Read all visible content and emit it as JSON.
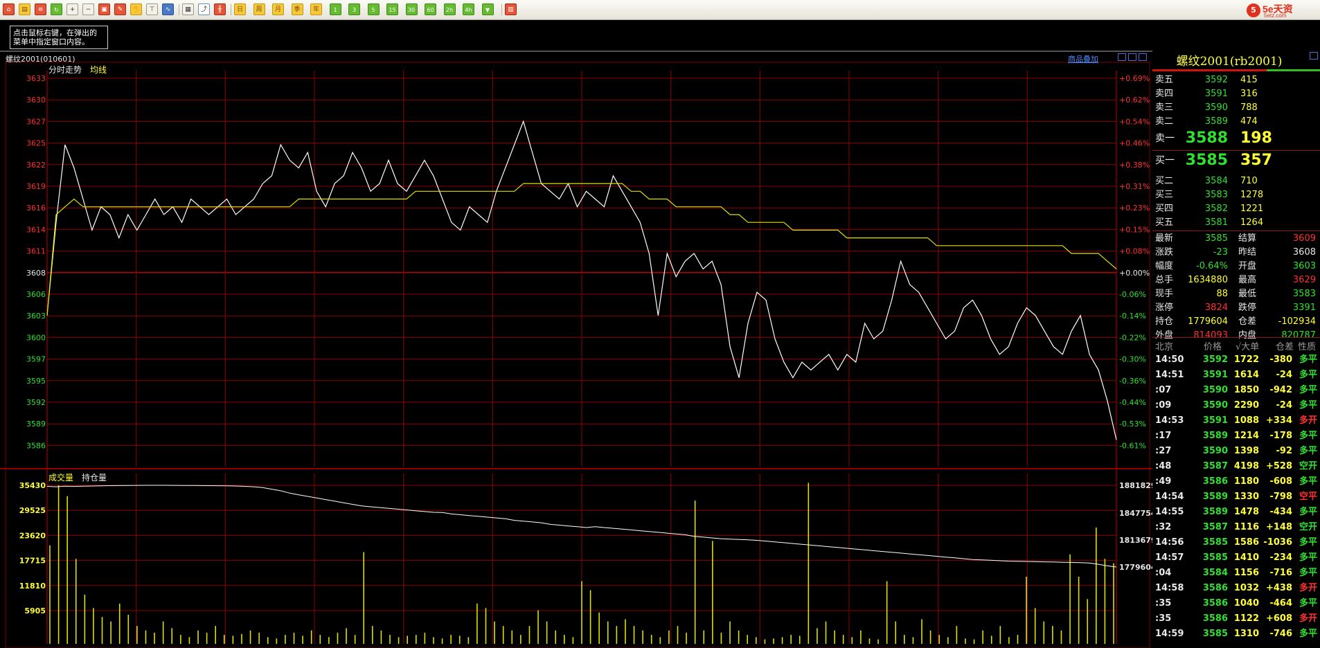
{
  "colors": {
    "red": "#ff3030",
    "green": "#30e030",
    "yellow": "#ffff33",
    "white": "#e8e8e8",
    "grid": "#8b0000",
    "price_line": "#ffffff",
    "avg_line": "#e0e000",
    "volume_bar": "#e0e000"
  },
  "toolbar": {
    "buttons": [
      {
        "name": "home-icon",
        "text": "⌂",
        "style": "r"
      },
      {
        "name": "folder-icon",
        "text": "▤",
        "style": "y"
      },
      {
        "name": "news-icon",
        "text": "≡",
        "style": "r"
      },
      {
        "name": "refresh-icon",
        "text": "↻",
        "style": "g"
      },
      {
        "name": "zoom-in-icon",
        "text": "+",
        "style": ""
      },
      {
        "name": "zoom-out-icon",
        "text": "−",
        "style": ""
      },
      {
        "name": "color-icon",
        "text": "▣",
        "style": "r"
      },
      {
        "name": "pen-icon",
        "text": "✎",
        "style": "r"
      },
      {
        "name": "hand-icon",
        "text": "✋",
        "style": "y"
      },
      {
        "name": "brush-icon",
        "text": "⊤",
        "style": ""
      },
      {
        "name": "trend-icon",
        "text": "∿",
        "style": "b"
      },
      {
        "name": "table-icon",
        "text": "▦",
        "style": ""
      },
      {
        "name": "intraday-chart-icon",
        "text": "⤴",
        "style": "active"
      },
      {
        "name": "kline-icon",
        "text": "╫",
        "style": "r"
      },
      {
        "name": "day-button",
        "text": "日",
        "style": "y"
      },
      {
        "name": "week-button",
        "text": "周",
        "style": "y"
      },
      {
        "name": "month-button",
        "text": "月",
        "style": "y"
      },
      {
        "name": "quarter-button",
        "text": "季",
        "style": "y"
      },
      {
        "name": "year-button",
        "text": "年",
        "style": "y"
      },
      {
        "name": "min1-button",
        "text": "1",
        "style": "g"
      },
      {
        "name": "min3-button",
        "text": "3",
        "style": "g"
      },
      {
        "name": "min5-button",
        "text": "5",
        "style": "g"
      },
      {
        "name": "min15-button",
        "text": "15",
        "style": "g"
      },
      {
        "name": "min30-button",
        "text": "30",
        "style": "g"
      },
      {
        "name": "min60-button",
        "text": "60",
        "style": "g"
      },
      {
        "name": "hour2-button",
        "text": "2h",
        "style": "g"
      },
      {
        "name": "hour4-button",
        "text": "4h",
        "style": "g"
      },
      {
        "name": "filter-icon",
        "text": "▼",
        "style": "g"
      },
      {
        "name": "calendar-icon",
        "text": "▥",
        "style": "r"
      }
    ],
    "logo": {
      "badge": "5",
      "name": "5e天资",
      "domain": "5etz.com"
    }
  },
  "hint": {
    "line1": "点击鼠标右键，在弹出的",
    "line2": "菜单中指定窗口内容。"
  },
  "chart": {
    "title": "螺纹2001(010601)",
    "overlay_link": "商品叠加",
    "price_label": "分时走势",
    "avg_label": "均线",
    "volume_label": "成交量",
    "oi_label": "持仓量",
    "price_ticks": [
      "3633",
      "3630",
      "3627",
      "3625",
      "3622",
      "3619",
      "3616",
      "3614",
      "3611",
      "3608",
      "3606",
      "3603",
      "3600",
      "3597",
      "3595",
      "3592",
      "3589",
      "3586"
    ],
    "pct_ticks": [
      "+0.69%",
      "+0.62%",
      "+0.54%",
      "+0.46%",
      "+0.38%",
      "+0.31%",
      "+0.23%",
      "+0.15%",
      "+0.08%",
      "+0.00%",
      "-0.06%",
      "-0.14%",
      "-0.22%",
      "-0.30%",
      "-0.36%",
      "-0.44%",
      "-0.53%",
      "-0.61%"
    ],
    "volume_ticks": [
      "35430",
      "29525",
      "23620",
      "17715",
      "11810",
      "5905"
    ],
    "oi_ticks": [
      "1881829",
      "1847754",
      "1813679",
      "1779604"
    ]
  },
  "chart_data": {
    "type": "line",
    "title": "螺纹2001(010601)",
    "xlabel": "",
    "ylabel": "",
    "reference_price": 3608,
    "ylim": [
      3584,
      3634
    ],
    "series": [
      {
        "name": "分时走势",
        "values": [
          3603,
          3615,
          3625,
          3622,
          3618,
          3614,
          3617,
          3616,
          3613,
          3616,
          3614,
          3616,
          3618,
          3616,
          3617,
          3615,
          3618,
          3617,
          3616,
          3617,
          3618,
          3616,
          3617,
          3618,
          3620,
          3621,
          3625,
          3623,
          3622,
          3624,
          3619,
          3617,
          3620,
          3621,
          3624,
          3622,
          3619,
          3620,
          3623,
          3620,
          3619,
          3621,
          3623,
          3621,
          3618,
          3615,
          3614,
          3617,
          3616,
          3615,
          3619,
          3622,
          3625,
          3628,
          3624,
          3620,
          3619,
          3618,
          3620,
          3617,
          3619,
          3618,
          3617,
          3621,
          3619,
          3617,
          3615,
          3611,
          3603,
          3611,
          3608,
          3610,
          3611,
          3609,
          3610,
          3607,
          3599,
          3595,
          3602,
          3606,
          3605,
          3600,
          3597,
          3595,
          3597,
          3596,
          3597,
          3598,
          3596,
          3598,
          3597,
          3602,
          3600,
          3601,
          3605,
          3610,
          3607,
          3606,
          3604,
          3602,
          3600,
          3601,
          3604,
          3605,
          3603,
          3600,
          3598,
          3599,
          3602,
          3604,
          3603,
          3601,
          3599,
          3598,
          3601,
          3603,
          3598,
          3596,
          3592,
          3587
        ],
        "color": "#ffffff"
      },
      {
        "name": "均线",
        "values": [
          3603,
          3616,
          3617,
          3618,
          3617,
          3617,
          3617,
          3617,
          3617,
          3617,
          3617,
          3617,
          3617,
          3617,
          3617,
          3617,
          3617,
          3617,
          3617,
          3617,
          3617,
          3617,
          3617,
          3617,
          3617,
          3617,
          3617,
          3617,
          3618,
          3618,
          3618,
          3618,
          3618,
          3618,
          3618,
          3618,
          3618,
          3618,
          3618,
          3618,
          3618,
          3619,
          3619,
          3619,
          3619,
          3619,
          3619,
          3619,
          3619,
          3619,
          3619,
          3619,
          3619,
          3620,
          3620,
          3620,
          3620,
          3620,
          3620,
          3620,
          3620,
          3620,
          3620,
          3620,
          3620,
          3619,
          3619,
          3618,
          3618,
          3618,
          3617,
          3617,
          3617,
          3617,
          3617,
          3617,
          3616,
          3616,
          3615,
          3615,
          3615,
          3615,
          3615,
          3614,
          3614,
          3614,
          3614,
          3614,
          3614,
          3613,
          3613,
          3613,
          3613,
          3613,
          3613,
          3613,
          3613,
          3613,
          3613,
          3612,
          3612,
          3612,
          3612,
          3612,
          3612,
          3612,
          3612,
          3612,
          3612,
          3612,
          3612,
          3612,
          3612,
          3612,
          3611,
          3611,
          3611,
          3611,
          3610,
          3609
        ],
        "color": "#e0e000"
      }
    ],
    "volume": {
      "ylim": [
        0,
        35430
      ],
      "values": [
        22000,
        35430,
        33000,
        19000,
        11000,
        8000,
        6000,
        5000,
        9000,
        6500,
        4000,
        3000,
        2500,
        5000,
        3500,
        2000,
        1500,
        3000,
        2500,
        4000,
        2000,
        1800,
        2200,
        3000,
        2500,
        1500,
        1200,
        2000,
        2500,
        1800,
        3000,
        2000,
        1500,
        2500,
        3500,
        2000,
        20500,
        4000,
        3000,
        2000,
        1500,
        1800,
        2000,
        2500,
        1500,
        1200,
        2000,
        1800,
        1500,
        9000,
        8000,
        5000,
        4000,
        3000,
        2000,
        4000,
        7500,
        5000,
        3000,
        2000,
        1500,
        14000,
        12000,
        7000,
        5000,
        4000,
        5500,
        4000,
        3000,
        2000,
        1500,
        3000,
        4000,
        2500,
        32000,
        3000,
        23000,
        2500,
        5000,
        3000,
        2000,
        1500,
        1000,
        1200,
        1500,
        2000,
        1800,
        36000,
        3500,
        5000,
        3000,
        2000,
        1500,
        3000,
        1200,
        1000,
        14000,
        5000,
        2000,
        1500,
        5500,
        3000,
        2000,
        1500,
        4000,
        1200,
        1000,
        3000,
        1800,
        4000,
        1500,
        2000,
        15000,
        8000,
        5000,
        4000,
        3000,
        20000,
        15000,
        10000,
        26000,
        19000,
        18000
      ]
    },
    "open_interest": {
      "series_name": "持仓量",
      "ylim": [
        1779604,
        1881829
      ],
      "values": [
        1880500,
        1880000,
        1880800,
        1880500,
        1880800,
        1881000,
        1881200,
        1881400,
        1881500,
        1881600,
        1881700,
        1881800,
        1881829,
        1881800,
        1881700,
        1881600,
        1881600,
        1881500,
        1881400,
        1881300,
        1881200,
        1881000,
        1880500,
        1880000,
        1879000,
        1877000,
        1875000,
        1872000,
        1870000,
        1868000,
        1866000,
        1864000,
        1862000,
        1860000,
        1858000,
        1856000,
        1855000,
        1854000,
        1853000,
        1852000,
        1851000,
        1850000,
        1849000,
        1848000,
        1847754,
        1846000,
        1845000,
        1844000,
        1843000,
        1842000,
        1841000,
        1840000,
        1838000,
        1837000,
        1836000,
        1835000,
        1833000,
        1832000,
        1831000,
        1830000,
        1829000,
        1830000,
        1829000,
        1828000,
        1827000,
        1826000,
        1825000,
        1824000,
        1823000,
        1822000,
        1821000,
        1820000,
        1818000,
        1817000,
        1816000,
        1815000,
        1814500,
        1814000,
        1813679,
        1813000,
        1812000,
        1811000,
        1810000,
        1809000,
        1808000,
        1807000,
        1806000,
        1805000,
        1804000,
        1803000,
        1802000,
        1801000,
        1800000,
        1799000,
        1798000,
        1797000,
        1796000,
        1795000,
        1794000,
        1793000,
        1792000,
        1791000,
        1790000,
        1789000,
        1788500,
        1788000,
        1787500,
        1787000,
        1786800,
        1786500,
        1786300,
        1786000,
        1785800,
        1785500,
        1785300,
        1785000,
        1784500,
        1783000,
        1781000,
        1779604
      ]
    }
  },
  "quote": {
    "title": "螺纹2001(rb2001)",
    "asks": [
      {
        "label": "卖五",
        "price": "3592",
        "vol": "415"
      },
      {
        "label": "卖四",
        "price": "3591",
        "vol": "316"
      },
      {
        "label": "卖三",
        "price": "3590",
        "vol": "788"
      },
      {
        "label": "卖二",
        "price": "3589",
        "vol": "474"
      },
      {
        "label": "卖一",
        "price": "3588",
        "vol": "198"
      }
    ],
    "bids": [
      {
        "label": "买一",
        "price": "3585",
        "vol": "357"
      },
      {
        "label": "买二",
        "price": "3584",
        "vol": "710"
      },
      {
        "label": "买三",
        "price": "3583",
        "vol": "1278"
      },
      {
        "label": "买四",
        "price": "3582",
        "vol": "1221"
      },
      {
        "label": "买五",
        "price": "3581",
        "vol": "1264"
      }
    ],
    "stats": [
      {
        "l1": "最新",
        "v1": "3585",
        "c1": "green",
        "l2": "结算",
        "v2": "3609",
        "c2": "red"
      },
      {
        "l1": "涨跌",
        "v1": "-23",
        "c1": "green",
        "l2": "昨结",
        "v2": "3608",
        "c2": "white"
      },
      {
        "l1": "幅度",
        "v1": "-0.64%",
        "c1": "green",
        "l2": "开盘",
        "v2": "3603",
        "c2": "green"
      },
      {
        "l1": "总手",
        "v1": "1634880",
        "c1": "yellow",
        "l2": "最高",
        "v2": "3629",
        "c2": "red"
      },
      {
        "l1": "现手",
        "v1": "88",
        "c1": "yellow",
        "l2": "最低",
        "v2": "3583",
        "c2": "green"
      },
      {
        "l1": "涨停",
        "v1": "3824",
        "c1": "red",
        "l2": "跌停",
        "v2": "3391",
        "c2": "green"
      },
      {
        "l1": "持仓",
        "v1": "1779604",
        "c1": "yellow",
        "l2": "仓差",
        "v2": "-102934",
        "c2": "yellow"
      },
      {
        "l1": "外盘",
        "v1": "814093",
        "c1": "red",
        "l2": "内盘",
        "v2": "820787",
        "c2": "green"
      }
    ],
    "ticks_header": {
      "time": "北京",
      "price": "价格",
      "vol": "√大单",
      "diff": "仓差",
      "nature": "性质"
    },
    "ticks": [
      {
        "t": "14:50",
        "p": "3592",
        "v": "1722",
        "d": "-380",
        "n": "多平",
        "nc": "green"
      },
      {
        "t": "14:51",
        "p": "3591",
        "v": "1614",
        "d": "-24",
        "n": "多平",
        "nc": "green"
      },
      {
        "t": ":07",
        "p": "3590",
        "v": "1850",
        "d": "-942",
        "n": "多平",
        "nc": "green"
      },
      {
        "t": ":09",
        "p": "3590",
        "v": "2290",
        "d": "-24",
        "n": "多平",
        "nc": "green"
      },
      {
        "t": "14:53",
        "p": "3591",
        "v": "1088",
        "d": "+334",
        "n": "多开",
        "nc": "red"
      },
      {
        "t": ":17",
        "p": "3589",
        "v": "1214",
        "d": "-178",
        "n": "多平",
        "nc": "green"
      },
      {
        "t": ":27",
        "p": "3590",
        "v": "1398",
        "d": "-92",
        "n": "多平",
        "nc": "green"
      },
      {
        "t": ":48",
        "p": "3587",
        "v": "4198",
        "d": "+528",
        "n": "空开",
        "nc": "green"
      },
      {
        "t": ":49",
        "p": "3586",
        "v": "1180",
        "d": "-608",
        "n": "多平",
        "nc": "green"
      },
      {
        "t": "14:54",
        "p": "3589",
        "v": "1330",
        "d": "-798",
        "n": "空平",
        "nc": "red"
      },
      {
        "t": "14:55",
        "p": "3589",
        "v": "1478",
        "d": "-434",
        "n": "多平",
        "nc": "green"
      },
      {
        "t": ":32",
        "p": "3587",
        "v": "1116",
        "d": "+148",
        "n": "空开",
        "nc": "green"
      },
      {
        "t": "14:56",
        "p": "3585",
        "v": "1586",
        "d": "-1036",
        "n": "多平",
        "nc": "green"
      },
      {
        "t": "14:57",
        "p": "3585",
        "v": "1410",
        "d": "-234",
        "n": "多平",
        "nc": "green"
      },
      {
        "t": ":04",
        "p": "3584",
        "v": "1156",
        "d": "-716",
        "n": "多平",
        "nc": "green"
      },
      {
        "t": "14:58",
        "p": "3586",
        "v": "1032",
        "d": "+438",
        "n": "多开",
        "nc": "red"
      },
      {
        "t": ":35",
        "p": "3586",
        "v": "1040",
        "d": "-464",
        "n": "多平",
        "nc": "green"
      },
      {
        "t": ":35",
        "p": "3586",
        "v": "1122",
        "d": "+608",
        "n": "多开",
        "nc": "red"
      },
      {
        "t": "14:59",
        "p": "3585",
        "v": "1310",
        "d": "-746",
        "n": "多平",
        "nc": "green"
      }
    ]
  }
}
